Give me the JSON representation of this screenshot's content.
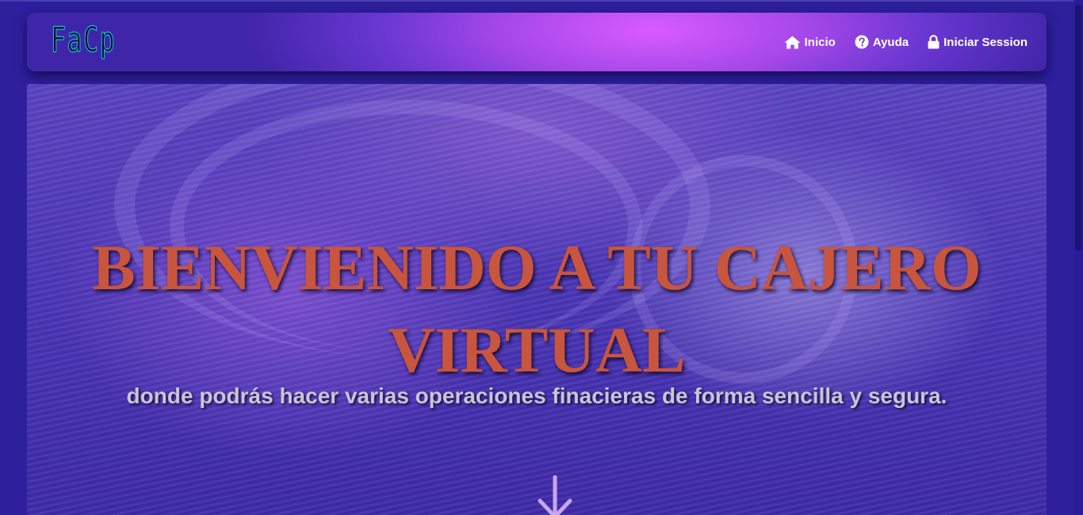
{
  "brand": {
    "logo_text": "FaCp"
  },
  "nav": {
    "items": [
      {
        "label": "Inicio",
        "icon": "home-icon"
      },
      {
        "label": "Ayuda",
        "icon": "question-circle-icon"
      },
      {
        "label": "Iniciar Session",
        "icon": "lock-icon"
      }
    ]
  },
  "hero": {
    "title": "BIENVIENIDO A TU CAJERO VIRTUAL",
    "subtitle": "donde podrás hacer varias operaciones finacieras de forma sencilla y segura.",
    "scroll_icon": "arrow-down-icon"
  },
  "colors": {
    "page_background": "#2e1f9c",
    "navbar_highlight": "#d95bff",
    "title_color": "#c8553d",
    "subtitle_color": "#c9c5d6",
    "logo_stroke": "#17d4e8",
    "arrow_color": "#c9a6f2"
  }
}
